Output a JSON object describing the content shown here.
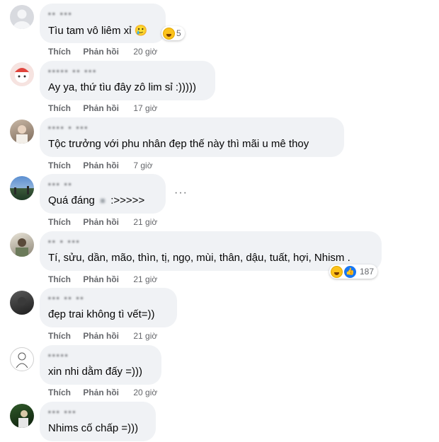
{
  "comments": [
    {
      "name": "▪▪ ▪▪▪",
      "text": "Tìu tam vô liêm xỉ 🥲",
      "like": "Thích",
      "reply": "Phản hồi",
      "time": "20 giờ",
      "reaction_count": "5"
    },
    {
      "name": "▪▪▪▪▪ ▪▪ ▪▪▪",
      "text": "Ay ya, thứ tìu đây zô lim sỉ :)))))",
      "like": "Thích",
      "reply": "Phản hồi",
      "time": "17 giờ"
    },
    {
      "name": "▪▪▪▪ ▪ ▪▪▪",
      "text": "Tộc trưởng với phu nhân đẹp thế này thì mãi u mê thoy",
      "like": "Thích",
      "reply": "Phản hồi",
      "time": "7 giờ"
    },
    {
      "name": "▪▪▪ ▪▪",
      "text": "Quá đáng",
      "text_suffix": ":>>>>>",
      "like": "Thích",
      "reply": "Phản hồi",
      "time": "21 giờ",
      "more": "···"
    },
    {
      "name": "▪▪ ▪ ▪▪▪",
      "text": "Tí, sửu, dần, mão, thìn, tị, ngọ, mùi, thân, dậu, tuất, hợi, Nhism .",
      "like": "Thích",
      "reply": "Phản hồi",
      "time": "21 giờ",
      "reaction_count": "187"
    },
    {
      "name": "▪▪▪ ▪▪ ▪▪",
      "text": "đẹp trai không tì vết=))",
      "like": "Thích",
      "reply": "Phản hồi",
      "time": "21 giờ"
    },
    {
      "name": "▪▪▪▪▪",
      "text": "xin nhi dằm đấy =)))",
      "like": "Thích",
      "reply": "Phản hồi",
      "time": "20 giờ"
    },
    {
      "name": "▪▪▪ ▪▪▪",
      "text": "Nhims cố chấp =)))"
    }
  ],
  "colors": {
    "bubble": "#f0f2f5",
    "secondary_text": "#65676b",
    "primary_text": "#050505",
    "like_blue": "#1877f2"
  }
}
